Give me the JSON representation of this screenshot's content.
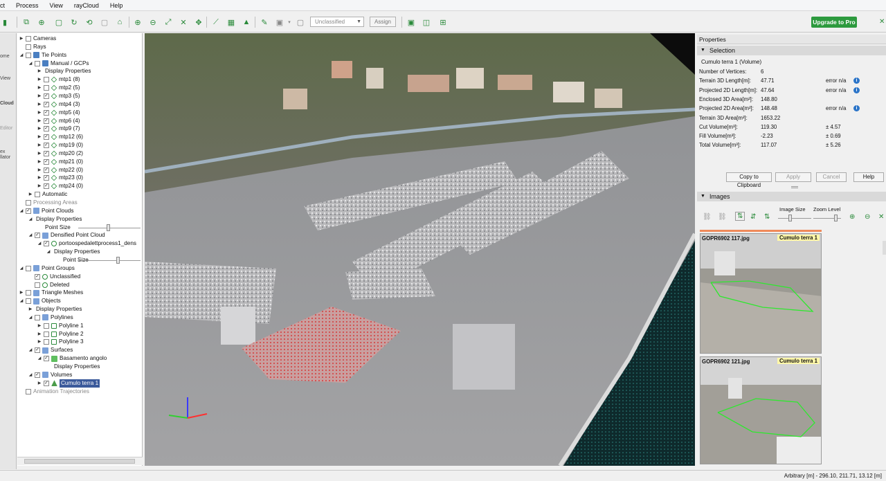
{
  "menu": {
    "items": [
      "Process",
      "View",
      "rayCloud",
      "Help"
    ],
    "partial_first": "ct"
  },
  "toolbar": {
    "classification_select": "Unclassified",
    "assign_label": "Assign",
    "upgrade_label": "Upgrade to Pro"
  },
  "left_strip": {
    "labels": [
      "ome",
      "View",
      "Cloud",
      "Editor",
      "ex",
      "llator"
    ]
  },
  "tree": {
    "nodes": [
      {
        "label": "Cameras",
        "level": 0,
        "toggle": "▶",
        "check": "",
        "icon": ""
      },
      {
        "label": "Rays",
        "level": 0,
        "toggle": "",
        "check": "",
        "icon": ""
      },
      {
        "label": "Tie Points",
        "level": 0,
        "toggle": "◢",
        "check": "",
        "icon": "tie"
      },
      {
        "label": "Manual / GCPs",
        "level": 1,
        "toggle": "◢",
        "check": "",
        "icon": "tie"
      },
      {
        "label": "Display Properties",
        "level": 2,
        "toggle": "▶",
        "check": "none",
        "icon": ""
      },
      {
        "label": "mtp1 (8)",
        "level": 2,
        "toggle": "▶",
        "check": "",
        "icon": "mtp"
      },
      {
        "label": "mtp2 (5)",
        "level": 2,
        "toggle": "▶",
        "check": "",
        "icon": "mtp"
      },
      {
        "label": "mtp3 (5)",
        "level": 2,
        "toggle": "▶",
        "check": "✓",
        "icon": "mtp"
      },
      {
        "label": "mtp4 (3)",
        "level": 2,
        "toggle": "▶",
        "check": "✓",
        "icon": "mtp"
      },
      {
        "label": "mtp5 (4)",
        "level": 2,
        "toggle": "▶",
        "check": "✓",
        "icon": "mtp"
      },
      {
        "label": "mtp6 (4)",
        "level": 2,
        "toggle": "▶",
        "check": "✓",
        "icon": "mtp"
      },
      {
        "label": "mtp9 (7)",
        "level": 2,
        "toggle": "▶",
        "check": "✓",
        "icon": "mtp"
      },
      {
        "label": "mtp12 (6)",
        "level": 2,
        "toggle": "▶",
        "check": "✓",
        "icon": "mtp"
      },
      {
        "label": "mtp19 (0)",
        "level": 2,
        "toggle": "▶",
        "check": "✓",
        "icon": "mtp"
      },
      {
        "label": "mtp20 (2)",
        "level": 2,
        "toggle": "▶",
        "check": "✓",
        "icon": "mtp"
      },
      {
        "label": "mtp21 (0)",
        "level": 2,
        "toggle": "▶",
        "check": "✓",
        "icon": "mtp"
      },
      {
        "label": "mtp22 (0)",
        "level": 2,
        "toggle": "▶",
        "check": "✓",
        "icon": "mtp"
      },
      {
        "label": "mtp23 (0)",
        "level": 2,
        "toggle": "▶",
        "check": "✓",
        "icon": "mtp"
      },
      {
        "label": "mtp24 (0)",
        "level": 2,
        "toggle": "▶",
        "check": "✓",
        "icon": "mtp"
      },
      {
        "label": "Automatic",
        "level": 1,
        "toggle": "▶",
        "check": "",
        "icon": ""
      },
      {
        "label": "Processing Areas",
        "level": 0,
        "toggle": "",
        "check": "",
        "icon": "",
        "grey": true
      },
      {
        "label": "Point Clouds",
        "level": 0,
        "toggle": "◢",
        "check": "✓",
        "icon": "pc"
      },
      {
        "label": "Display Properties",
        "level": 1,
        "toggle": "◢",
        "check": "none",
        "icon": ""
      },
      {
        "label": "Point Size",
        "level": 2,
        "toggle": "",
        "check": "none",
        "icon": "",
        "slider": 156
      },
      {
        "label": "Densified Point Cloud",
        "level": 1,
        "toggle": "◢",
        "check": "✓",
        "icon": "pc"
      },
      {
        "label": "portoospedalettprocess1_dens",
        "level": 2,
        "toggle": "◢",
        "check": "✓",
        "icon": "grp"
      },
      {
        "label": "Display Properties",
        "level": 3,
        "toggle": "◢",
        "check": "none",
        "icon": ""
      },
      {
        "label": "Point Size",
        "level": 4,
        "toggle": "",
        "check": "none",
        "icon": "",
        "slider": 170
      },
      {
        "label": "Point Groups",
        "level": 0,
        "toggle": "◢",
        "check": "",
        "icon": "pc"
      },
      {
        "label": "Unclassified",
        "level": 1,
        "toggle": "",
        "check": "✓",
        "icon": "grp"
      },
      {
        "label": "Deleted",
        "level": 1,
        "toggle": "",
        "check": "",
        "icon": "grp"
      },
      {
        "label": "Triangle Meshes",
        "level": 0,
        "toggle": "▶",
        "check": "",
        "icon": "pc"
      },
      {
        "label": "Objects",
        "level": 0,
        "toggle": "◢",
        "check": "",
        "icon": "pc"
      },
      {
        "label": "Display Properties",
        "level": 1,
        "toggle": "▶",
        "check": "none",
        "icon": ""
      },
      {
        "label": "Polylines",
        "level": 1,
        "toggle": "◢",
        "check": "",
        "icon": "pc"
      },
      {
        "label": "Polyline 1",
        "level": 2,
        "toggle": "▶",
        "check": "",
        "icon": "pl"
      },
      {
        "label": "Polyline 2",
        "level": 2,
        "toggle": "▶",
        "check": "",
        "icon": "pl"
      },
      {
        "label": "Polyline 3",
        "level": 2,
        "toggle": "▶",
        "check": "",
        "icon": "pl"
      },
      {
        "label": "Surfaces",
        "level": 1,
        "toggle": "◢",
        "check": "✓",
        "icon": "pc"
      },
      {
        "label": "Basamento angolo",
        "level": 2,
        "toggle": "◢",
        "check": "✓",
        "icon": "surf"
      },
      {
        "label": "Display Properties",
        "level": 3,
        "toggle": "",
        "check": "none",
        "icon": ""
      },
      {
        "label": "Volumes",
        "level": 1,
        "toggle": "◢",
        "check": "✓",
        "icon": "pc"
      },
      {
        "label": "Cumulo terra 1",
        "level": 2,
        "toggle": "▶",
        "check": "✓",
        "icon": "vol",
        "selected": true
      },
      {
        "label": "Animation Trajectories",
        "level": 0,
        "toggle": "",
        "check": "",
        "icon": "",
        "grey": true
      }
    ]
  },
  "properties": {
    "header": "Properties",
    "selection_header": "Selection",
    "selection_title": "Cumulo terra 1 (Volume)",
    "rows": [
      {
        "key": "Number of Vertices:",
        "value": "6",
        "extra": "",
        "info": false
      },
      {
        "key": "Terrain 3D Length[m]:",
        "value": "47.71",
        "extra": "error n/a",
        "info": true
      },
      {
        "key": "Projected 2D Length[m]:",
        "value": "47.64",
        "extra": "error n/a",
        "info": true
      },
      {
        "key": "Enclosed 3D Area[m²]:",
        "value": "148.80",
        "extra": "",
        "info": false
      },
      {
        "key": "Projected 2D Area[m²]:",
        "value": "148.48",
        "extra": "error n/a",
        "info": true
      },
      {
        "key": "Terrain 3D Area[m²]:",
        "value": "1653.22",
        "extra": "",
        "info": false
      },
      {
        "key": "Cut Volume[m³]:",
        "value": "119.30",
        "extra": "± 4.57",
        "info": false
      },
      {
        "key": "Fill Volume[m³]:",
        "value": "-2.23",
        "extra": "± 0.69",
        "info": false
      },
      {
        "key": "Total Volume[m³]:",
        "value": "117.07",
        "extra": "± 5.26",
        "info": false
      }
    ],
    "buttons": {
      "copy": "Copy to Clipboard",
      "apply": "Apply",
      "cancel": "Cancel",
      "help": "Help"
    },
    "images_header": "Images",
    "image_size_label": "Image Size",
    "zoom_level_label": "Zoom Level",
    "thumbnails": [
      {
        "name": "GOPR6902 117.jpg",
        "tag": "Cumulo terra 1"
      },
      {
        "name": "GOPR6902 121.jpg",
        "tag": "Cumulo terra 1"
      }
    ]
  },
  "status": {
    "text": "Arbitrary [m] - 296.10, 211.71, 13.12 [m]"
  },
  "colors": {
    "accent_green": "#2d9a3e",
    "selection_blue": "#3b5a9b",
    "info_blue": "#2b74c8",
    "polyline_green": "#2ee82e",
    "volume_red": "#d05050"
  }
}
